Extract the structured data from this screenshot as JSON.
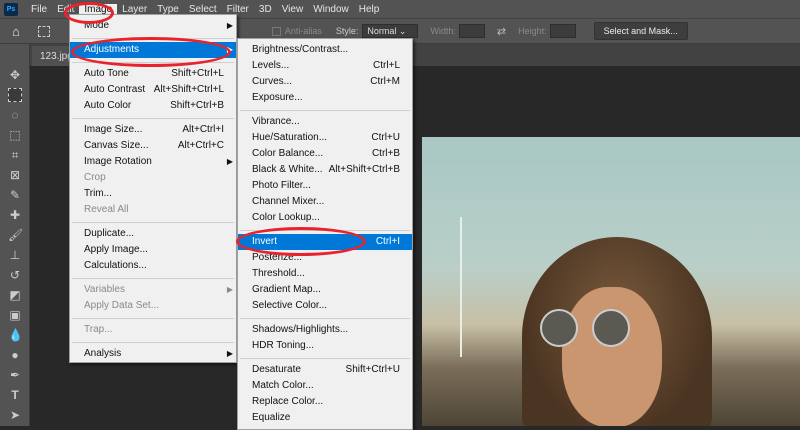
{
  "menubar": {
    "logo": "Ps",
    "items": [
      "File",
      "Edit",
      "Image",
      "Layer",
      "Type",
      "Select",
      "Filter",
      "3D",
      "View",
      "Window",
      "Help"
    ]
  },
  "options": {
    "anti_alias": "Anti-alias",
    "style_label": "Style:",
    "style_value": "Normal",
    "width_label": "Width:",
    "height_label": "Height:",
    "select_mask": "Select and Mask..."
  },
  "document_tab": "123.jpg",
  "image_menu": [
    {
      "label": "Mode",
      "submenu": true
    },
    {
      "sep": true
    },
    {
      "label": "Adjustments",
      "submenu": true,
      "highlight": true
    },
    {
      "sep": true
    },
    {
      "label": "Auto Tone",
      "shortcut": "Shift+Ctrl+L"
    },
    {
      "label": "Auto Contrast",
      "shortcut": "Alt+Shift+Ctrl+L"
    },
    {
      "label": "Auto Color",
      "shortcut": "Shift+Ctrl+B"
    },
    {
      "sep": true
    },
    {
      "label": "Image Size...",
      "shortcut": "Alt+Ctrl+I"
    },
    {
      "label": "Canvas Size...",
      "shortcut": "Alt+Ctrl+C"
    },
    {
      "label": "Image Rotation",
      "submenu": true
    },
    {
      "label": "Crop",
      "disabled": true
    },
    {
      "label": "Trim..."
    },
    {
      "label": "Reveal All",
      "disabled": true
    },
    {
      "sep": true
    },
    {
      "label": "Duplicate..."
    },
    {
      "label": "Apply Image..."
    },
    {
      "label": "Calculations..."
    },
    {
      "sep": true
    },
    {
      "label": "Variables",
      "submenu": true,
      "disabled": true
    },
    {
      "label": "Apply Data Set...",
      "disabled": true
    },
    {
      "sep": true
    },
    {
      "label": "Trap...",
      "disabled": true
    },
    {
      "sep": true
    },
    {
      "label": "Analysis",
      "submenu": true
    }
  ],
  "adjustments_menu": [
    {
      "label": "Brightness/Contrast..."
    },
    {
      "label": "Levels...",
      "shortcut": "Ctrl+L"
    },
    {
      "label": "Curves...",
      "shortcut": "Ctrl+M"
    },
    {
      "label": "Exposure..."
    },
    {
      "sep": true
    },
    {
      "label": "Vibrance..."
    },
    {
      "label": "Hue/Saturation...",
      "shortcut": "Ctrl+U"
    },
    {
      "label": "Color Balance...",
      "shortcut": "Ctrl+B"
    },
    {
      "label": "Black & White...",
      "shortcut": "Alt+Shift+Ctrl+B"
    },
    {
      "label": "Photo Filter..."
    },
    {
      "label": "Channel Mixer..."
    },
    {
      "label": "Color Lookup..."
    },
    {
      "sep": true
    },
    {
      "label": "Invert",
      "shortcut": "Ctrl+I",
      "highlight": true
    },
    {
      "label": "Posterize..."
    },
    {
      "label": "Threshold..."
    },
    {
      "label": "Gradient Map..."
    },
    {
      "label": "Selective Color..."
    },
    {
      "sep": true
    },
    {
      "label": "Shadows/Highlights..."
    },
    {
      "label": "HDR Toning..."
    },
    {
      "sep": true
    },
    {
      "label": "Desaturate",
      "shortcut": "Shift+Ctrl+U"
    },
    {
      "label": "Match Color..."
    },
    {
      "label": "Replace Color..."
    },
    {
      "label": "Equalize"
    }
  ],
  "colors": {
    "highlight": "#0078d7",
    "annotation": "#e8232d",
    "panel": "#535353"
  }
}
